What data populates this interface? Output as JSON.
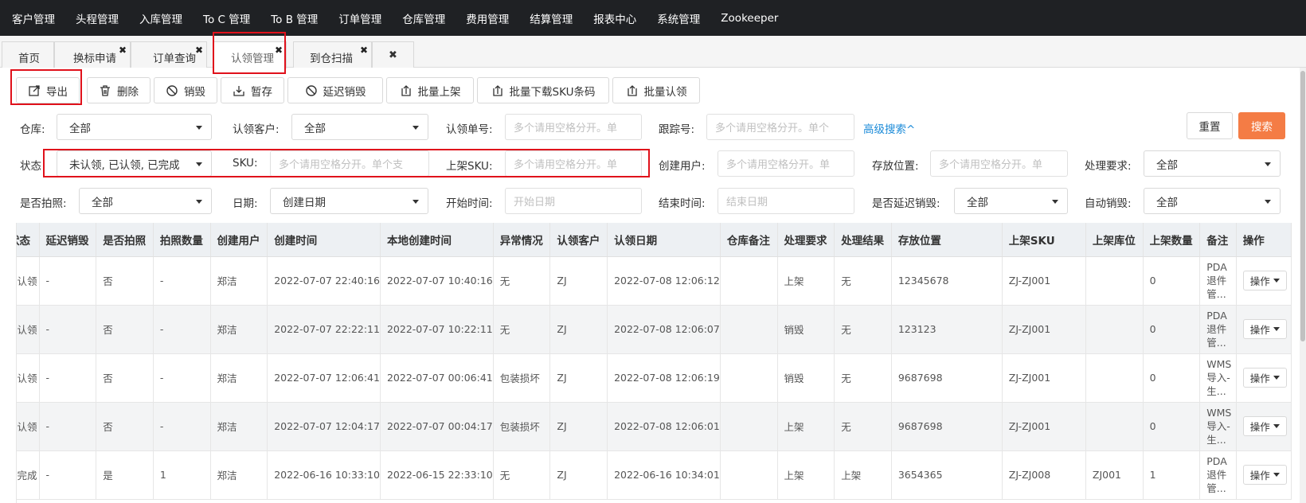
{
  "topnav": [
    "客户管理",
    "头程管理",
    "入库管理",
    "To C 管理",
    "To B 管理",
    "订单管理",
    "仓库管理",
    "费用管理",
    "结算管理",
    "报表中心",
    "系统管理",
    "Zookeeper"
  ],
  "tabs": {
    "home": "首页",
    "t1": "换标申请",
    "t2": "订单查询",
    "t3": "认领管理",
    "t4": "到仓扫描",
    "close": "✖"
  },
  "toolbar": {
    "export": "导出",
    "delete": "删除",
    "destroy": "销毁",
    "hold": "暂存",
    "delay_destroy": "延迟销毁",
    "batch_shelve": "批量上架",
    "batch_download_sku": "批量下载SKU条码",
    "batch_claim": "批量认领"
  },
  "filters": {
    "warehouse_label": "仓库:",
    "warehouse_value": "全部",
    "claim_customer_label": "认领客户:",
    "claim_customer_value": "全部",
    "claim_no_label": "认领单号:",
    "claim_no_placeholder": "多个请用空格分开。单",
    "tracking_label": "跟踪号:",
    "tracking_placeholder": "多个请用空格分开。单个",
    "advanced": "高级搜索^",
    "reset": "重置",
    "search": "搜索",
    "status_label": "状态",
    "status_value": "未认领, 已认领, 已完成",
    "sku_label": "SKU:",
    "sku_placeholder": "多个请用空格分开。单个支",
    "shelf_sku_label": "上架SKU:",
    "shelf_sku_placeholder": "多个请用空格分开。单",
    "creator_label": "创建用户:",
    "creator_placeholder": "多个请用空格分开。单",
    "location_label": "存放位置:",
    "location_placeholder": "多个请用空格分开。单",
    "requirement_label": "处理要求:",
    "requirement_value": "全部",
    "photo_label": "是否拍照:",
    "photo_value": "全部",
    "date_label": "日期:",
    "date_value": "创建日期",
    "start_label": "开始时间:",
    "start_placeholder": "开始日期",
    "end_label": "结束时间:",
    "end_placeholder": "结束日期",
    "delay_label": "是否延迟销毁:",
    "delay_value": "全部",
    "auto_label": "自动销毁:",
    "auto_value": "全部"
  },
  "table": {
    "headers": [
      "状态",
      "延迟销毁",
      "是否拍照",
      "拍照数量",
      "创建用户",
      "创建时间",
      "本地创建时间",
      "异常情况",
      "认领客户",
      "认领日期",
      "仓库备注",
      "处理要求",
      "处理结果",
      "存放位置",
      "上架SKU",
      "上架库位",
      "上架数量",
      "备注",
      "操作"
    ],
    "op_label": "操作",
    "rows": [
      [
        "已认领",
        "-",
        "否",
        "-",
        "郑洁",
        "2022-07-07 22:40:16",
        "2022-07-07 10:40:16",
        "无",
        "ZJ",
        "2022-07-08 12:06:12",
        "",
        "上架",
        "无",
        "12345678",
        "ZJ-ZJ001",
        "",
        "0",
        "PDA退件管..."
      ],
      [
        "已认领",
        "-",
        "否",
        "-",
        "郑洁",
        "2022-07-07 22:22:11",
        "2022-07-07 10:22:11",
        "无",
        "ZJ",
        "2022-07-08 12:06:07",
        "",
        "销毁",
        "无",
        "123123",
        "ZJ-ZJ001",
        "",
        "0",
        "PDA退件管..."
      ],
      [
        "已认领",
        "-",
        "否",
        "-",
        "郑洁",
        "2022-07-07 12:06:41",
        "2022-07-07 00:06:41",
        "包装损坏",
        "ZJ",
        "2022-07-08 12:06:19",
        "",
        "销毁",
        "无",
        "9687698",
        "ZJ-ZJ001",
        "",
        "0",
        "WMS导入-生..."
      ],
      [
        "已认领",
        "-",
        "否",
        "-",
        "郑洁",
        "2022-07-07 12:04:17",
        "2022-07-07 00:04:17",
        "包装损坏",
        "ZJ",
        "2022-07-08 12:06:01",
        "",
        "上架",
        "无",
        "9687698",
        "ZJ-ZJ001",
        "",
        "0",
        "WMS导入-生..."
      ],
      [
        "已完成",
        "-",
        "是",
        "1",
        "郑洁",
        "2022-06-16 10:33:10",
        "2022-06-15 22:33:10",
        "无",
        "ZJ",
        "2022-06-16 10:34:01",
        "",
        "上架",
        "上架",
        "3654365",
        "ZJ-ZJ008",
        "ZJ001",
        "1",
        "PDA退件管..."
      ]
    ]
  },
  "colors": {
    "nav_bg": "#1f2124",
    "highlight": "#e0111b",
    "search_btn": "#f47c45",
    "link": "#1a8ad8"
  }
}
